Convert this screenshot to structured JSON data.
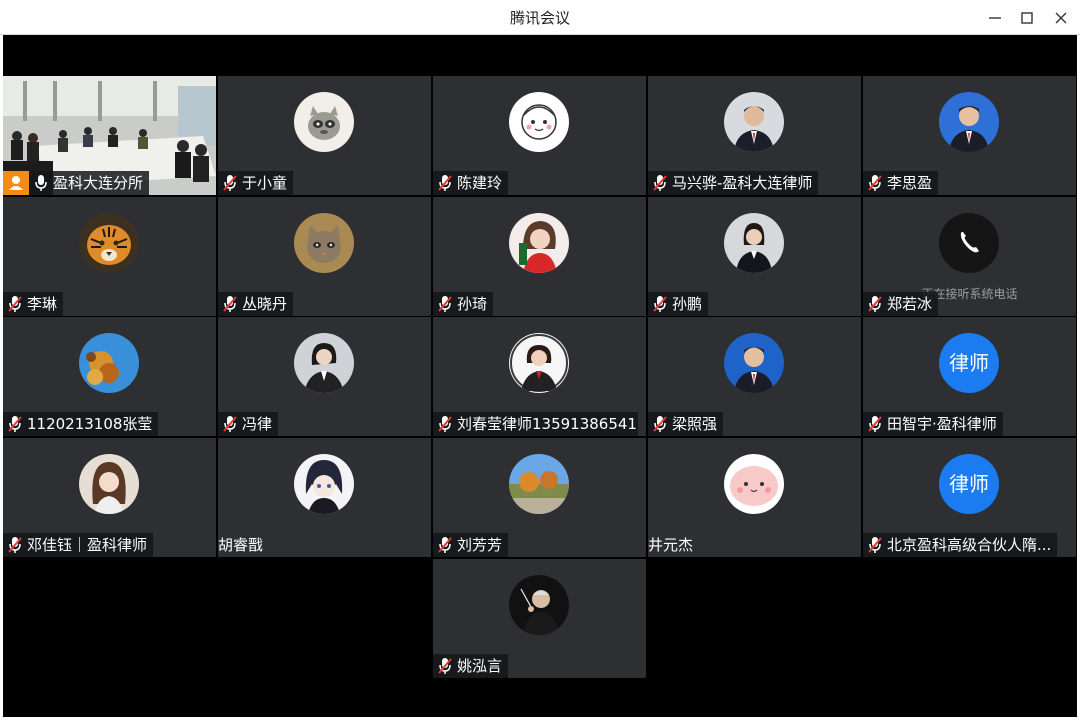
{
  "window": {
    "title": "腾讯会议"
  },
  "colors": {
    "tile_bg": "#2d2f32",
    "muted_red": "#e53935",
    "active_green": "#22c27a",
    "host_orange": "#f28c17",
    "lawyer_blue": "#1a7cf0"
  },
  "participants": [
    {
      "name": "盈科大连分所",
      "mic": "on",
      "video": "room",
      "host": true
    },
    {
      "name": "于小童",
      "mic": "muted",
      "avatar": "raccoon"
    },
    {
      "name": "陈建玲",
      "mic": "muted",
      "avatar": "cartoon-girl"
    },
    {
      "name": "马兴骅-盈科大连律师",
      "mic": "muted",
      "avatar": "man-suit"
    },
    {
      "name": "李思盈",
      "mic": "muted",
      "avatar": "man-suit-blue"
    },
    {
      "name": "李琳",
      "mic": "muted",
      "avatar": "tiger"
    },
    {
      "name": "丛晓丹",
      "mic": "muted",
      "avatar": "cat"
    },
    {
      "name": "孙琦",
      "mic": "muted",
      "avatar": "woman-red"
    },
    {
      "name": "孙鹏",
      "mic": "muted",
      "avatar": "woman-suit"
    },
    {
      "name": "郑若冰",
      "mic": "muted",
      "avatar": "phone",
      "status": "正在接听系统电话"
    },
    {
      "name": "1120213108张莹",
      "mic": "muted",
      "avatar": "leaves"
    },
    {
      "name": "冯律",
      "mic": "muted",
      "avatar": "woman-portrait"
    },
    {
      "name": "刘春莹律师13591386541",
      "mic": "muted",
      "avatar": "woman-suit-red"
    },
    {
      "name": "梁照强",
      "mic": "muted",
      "avatar": "man-blue-bg"
    },
    {
      "name": "田智宇·盈科律师",
      "mic": "muted",
      "avatar": "lawyer-text",
      "avatar_text": "律师"
    },
    {
      "name": "邓佳钰｜盈科律师",
      "mic": "muted",
      "avatar": "woman-hair"
    },
    {
      "name": "胡睿戬",
      "mic": "none",
      "avatar": "anime"
    },
    {
      "name": "刘芳芳",
      "mic": "muted",
      "avatar": "landscape"
    },
    {
      "name": "井元杰",
      "mic": "none",
      "avatar": "pink-blob"
    },
    {
      "name": "北京盈科高级合伙人隋...",
      "mic": "muted",
      "avatar": "lawyer-text",
      "avatar_text": "律师"
    },
    {
      "name": "姚泓言",
      "mic": "muted",
      "avatar": "conductor"
    }
  ]
}
